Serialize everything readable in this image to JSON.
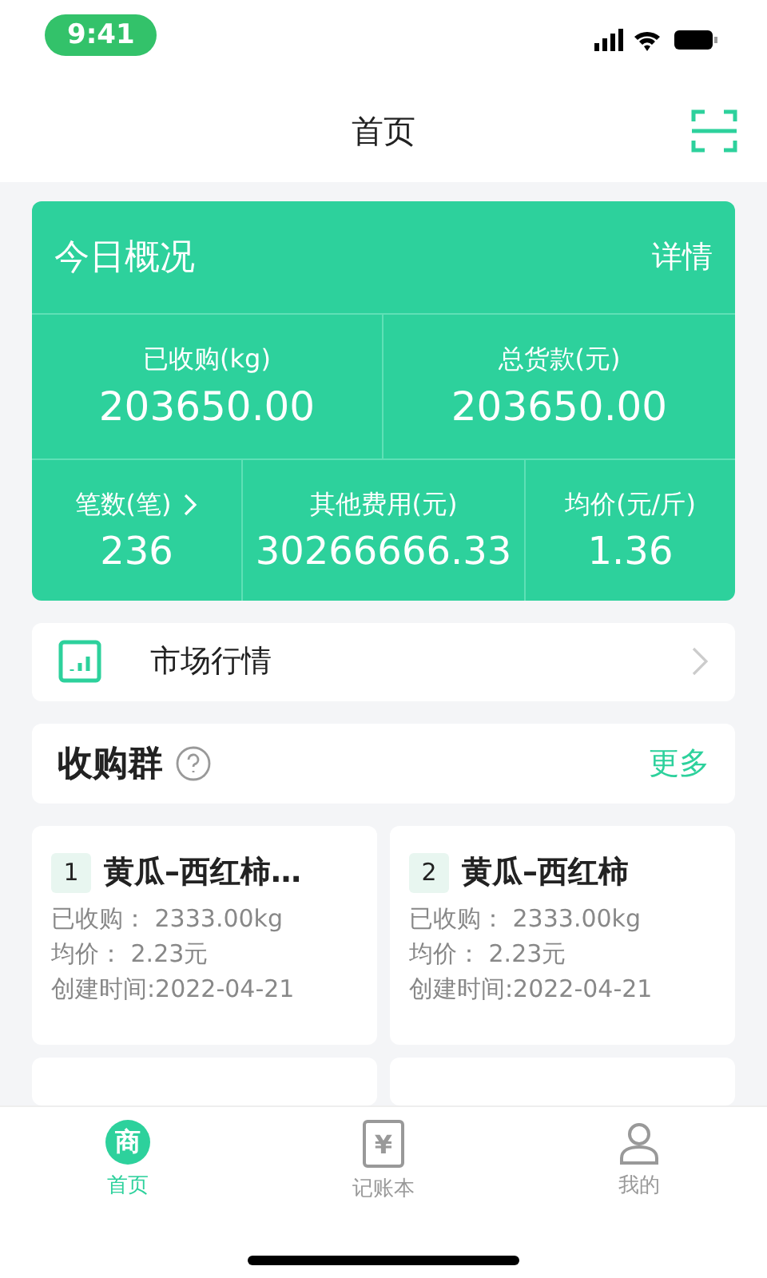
{
  "status_bar": {
    "time": "9:41"
  },
  "header": {
    "title": "首页"
  },
  "overview": {
    "title": "今日概况",
    "detail_link": "详情",
    "top_stats": [
      {
        "label": "已收购(kg)",
        "value": "203650.00"
      },
      {
        "label": "总货款(元)",
        "value": "203650.00"
      }
    ],
    "bottom_stats": [
      {
        "label": "笔数(笔)",
        "value": "236",
        "has_arrow": true
      },
      {
        "label": "其他费用(元)",
        "value": "30266666.33",
        "has_arrow": false
      },
      {
        "label": "均价(元/斤)",
        "value": "1.36",
        "has_arrow": false
      }
    ]
  },
  "market_row": {
    "label": "市场行情"
  },
  "groups": {
    "title": "收购群",
    "more": "更多",
    "cards": [
      {
        "index": "1",
        "name": "黄瓜–西红柿…",
        "purchased": "已收购：  2333.00kg",
        "price": "均价：  2.23元",
        "created": "创建时间:2022-04-21"
      },
      {
        "index": "2",
        "name": "黄瓜–西红柿",
        "purchased": "已收购：  2333.00kg",
        "price": "均价：  2.23元",
        "created": "创建时间:2022-04-21"
      }
    ]
  },
  "tab_bar": [
    {
      "label": "首页",
      "icon_text": "商",
      "kind": "shop",
      "selected": true
    },
    {
      "label": "记账本",
      "icon_text": "¥",
      "kind": "ledger",
      "selected": false
    },
    {
      "label": "我的",
      "kind": "person",
      "selected": false
    }
  ]
}
